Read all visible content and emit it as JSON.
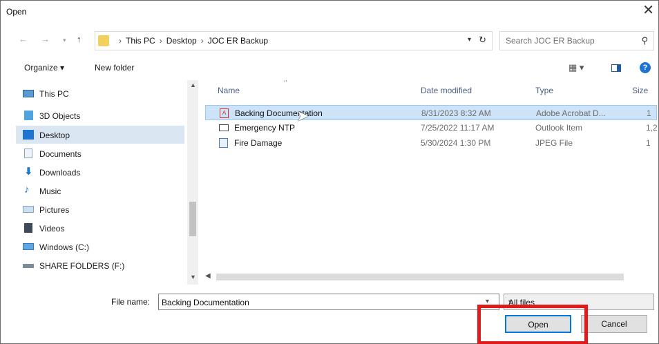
{
  "window": {
    "title": "Open",
    "close_glyph": "✕"
  },
  "addressbar": {
    "crumbs": [
      "This PC",
      "Desktop",
      "JOC ER Backup"
    ],
    "search_placeholder": "Search JOC ER Backup"
  },
  "toolbar": {
    "organize_label": "Organize ▾",
    "new_folder_label": "New folder"
  },
  "nav": {
    "items": [
      {
        "label": "This PC",
        "icon": "computer-icon"
      },
      {
        "label": "3D Objects",
        "icon": "3d-objects-icon"
      },
      {
        "label": "Desktop",
        "icon": "desktop-icon",
        "selected": true
      },
      {
        "label": "Documents",
        "icon": "documents-icon"
      },
      {
        "label": "Downloads",
        "icon": "downloads-icon"
      },
      {
        "label": "Music",
        "icon": "music-icon"
      },
      {
        "label": "Pictures",
        "icon": "pictures-icon"
      },
      {
        "label": "Videos",
        "icon": "videos-icon"
      },
      {
        "label": "Windows (C:)",
        "icon": "drive-icon"
      },
      {
        "label": "SHARE FOLDERS (F:)",
        "icon": "network-drive-icon"
      }
    ]
  },
  "columns": {
    "name": "Name",
    "date": "Date modified",
    "type": "Type",
    "size": "Size"
  },
  "files": [
    {
      "name": "Backing Documentation",
      "date": "8/31/2023 8:32 AM",
      "type": "Adobe Acrobat D...",
      "size": "1",
      "icon": "pdf-icon",
      "selected": true
    },
    {
      "name": "Emergency NTP",
      "date": "7/25/2022 11:17 AM",
      "type": "Outlook Item",
      "size": "1,2",
      "icon": "mail-icon"
    },
    {
      "name": "Fire Damage",
      "date": "5/30/2024 1:30 PM",
      "type": "JPEG File",
      "size": "1",
      "icon": "image-icon"
    }
  ],
  "bottom": {
    "filename_label": "File name:",
    "filename_value": "Backing Documentation",
    "filter_value": "All files",
    "open_label": "Open",
    "cancel_label": "Cancel"
  },
  "colors": {
    "selection": "#cde3f7",
    "highlight": "#e01b1b",
    "accent": "#0078d7"
  }
}
